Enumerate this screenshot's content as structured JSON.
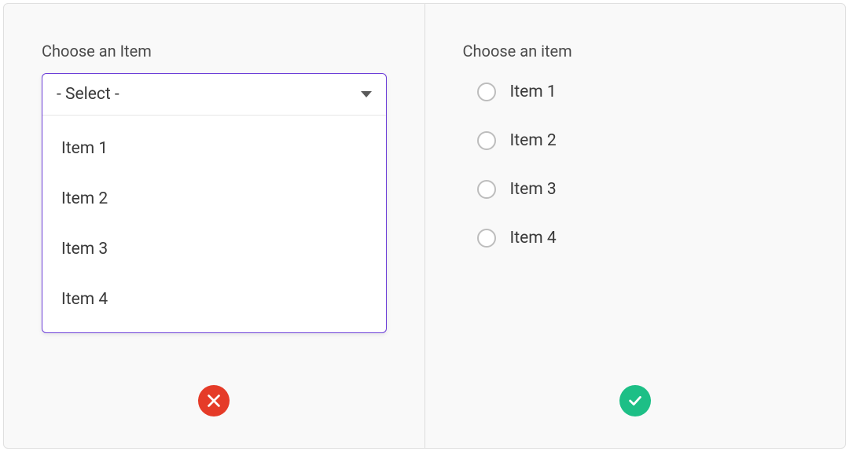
{
  "left": {
    "label": "Choose an Item",
    "select": {
      "placeholder": "- Select -",
      "options": [
        "Item 1",
        "Item 2",
        "Item 3",
        "Item 4"
      ]
    },
    "status": "error"
  },
  "right": {
    "label": "Choose an item",
    "radios": [
      "Item 1",
      "Item 2",
      "Item 3",
      "Item 4"
    ],
    "status": "success"
  },
  "colors": {
    "accent": "#6b3dd8",
    "error": "#e53b28",
    "success": "#1dbf86"
  }
}
